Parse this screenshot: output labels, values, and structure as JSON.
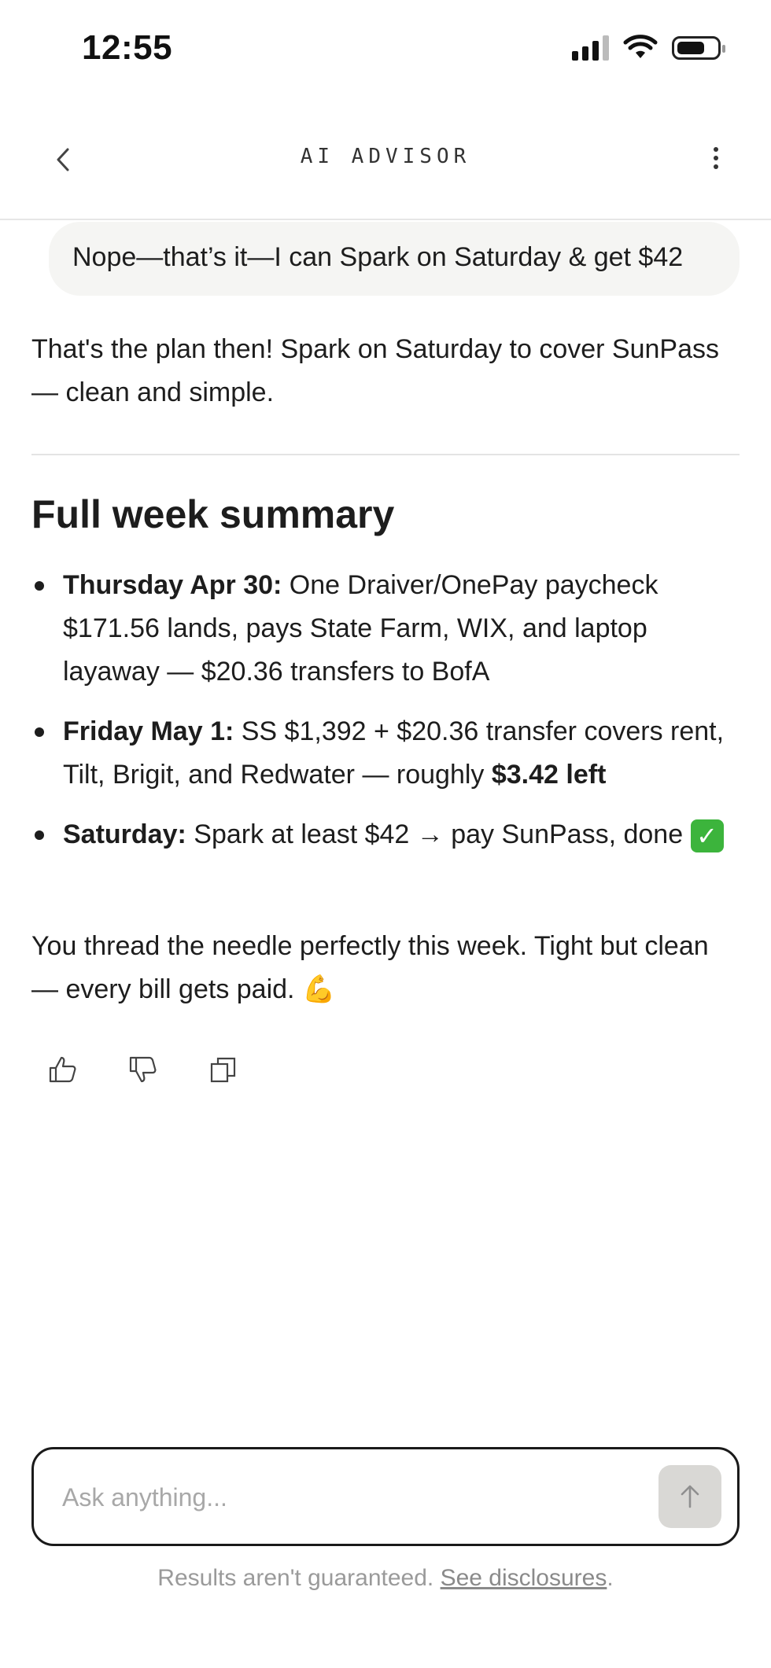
{
  "status": {
    "time": "12:55"
  },
  "nav": {
    "title": "AI ADVISOR"
  },
  "chat": {
    "user_message": "Nope—that’s it—I can Spark on Saturday & get $42",
    "reply_intro": "That's the plan then! Spark on Saturday to cover SunPass — clean and simple.",
    "summary_heading": "Full week summary",
    "bullets": [
      {
        "label": "Thursday Apr 30:",
        "text": " One Draiver/OnePay paycheck $171.56 lands, pays State Farm, WIX, and laptop layaway — $20.36 transfers to BofA"
      },
      {
        "label": "Friday May 1:",
        "text": " SS $1,392 + $20.36 transfer covers rent, Tilt, Brigit, and Redwater — roughly ",
        "strong": "$3.42 left"
      },
      {
        "label": "Saturday:",
        "text": " Spark at least $42 → pay SunPass, done ",
        "emoji": "✓"
      }
    ],
    "closing": "You thread the needle perfectly this week. Tight but clean — every bill gets paid. ",
    "closing_emoji": "💪"
  },
  "composer": {
    "placeholder": "Ask anything..."
  },
  "footer": {
    "text": "Results aren't guaranteed. ",
    "link": "See disclosures",
    "end": "."
  },
  "icons": [
    "chevron-left-icon",
    "more-vertical-icon",
    "thumbs-up-icon",
    "thumbs-down-icon",
    "copy-icon",
    "arrow-up-icon",
    "signal-icon",
    "wifi-icon",
    "battery-icon"
  ],
  "colors": {
    "bubble_bg": "#f5f5f3",
    "send_bg": "#d9d8d5",
    "text": "#1d1d1d",
    "muted": "#9a9a9a"
  }
}
